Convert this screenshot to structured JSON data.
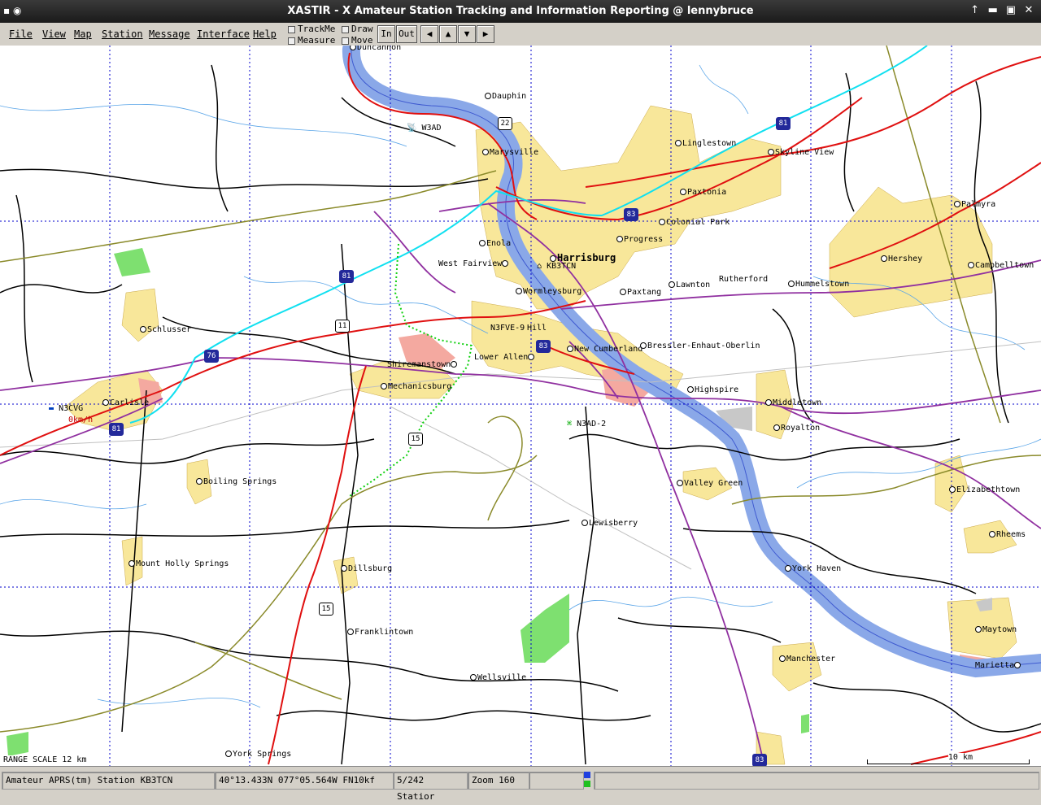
{
  "window": {
    "title": "XASTIR - X Amateur Station Tracking and Information Reporting @ lennybruce",
    "controls": [
      "↑",
      "▬",
      "▣",
      "✕"
    ]
  },
  "menu": {
    "items": [
      "File",
      "View",
      "Map",
      "Station",
      "Message",
      "Interface",
      "Help"
    ]
  },
  "toolbar": {
    "checks": [
      "TrackMe",
      "Measure",
      "Draw",
      "Move"
    ],
    "zoom_in": "In",
    "zoom_out": "Out",
    "arrows": [
      "◀",
      "▲",
      "▼",
      "▶"
    ]
  },
  "map": {
    "places": [
      {
        "name": "Duncannon"
      },
      {
        "name": "Dauphin"
      },
      {
        "name": "Marysville"
      },
      {
        "name": "Linglestown"
      },
      {
        "name": "Skyline View"
      },
      {
        "name": "Paxtonia"
      },
      {
        "name": "Colonial Park"
      },
      {
        "name": "Palmyra"
      },
      {
        "name": "Enola"
      },
      {
        "name": "Progress"
      },
      {
        "name": "Harrisburg"
      },
      {
        "name": "West Fairview"
      },
      {
        "name": "Hershey"
      },
      {
        "name": "Campbelltown"
      },
      {
        "name": "Wormleysburg"
      },
      {
        "name": "Paxtang"
      },
      {
        "name": "Lawnton"
      },
      {
        "name": "Rutherford"
      },
      {
        "name": "Hummelstown"
      },
      {
        "name": "Schlusser"
      },
      {
        "name": "Hill"
      },
      {
        "name": "New Cumberland"
      },
      {
        "name": "Bressler-Enhaut-Oberlin"
      },
      {
        "name": "Lower Allen"
      },
      {
        "name": "Shiremanstown"
      },
      {
        "name": "Mechanicsburg"
      },
      {
        "name": "Highspire"
      },
      {
        "name": "Middletown"
      },
      {
        "name": "Carlisle"
      },
      {
        "name": "Royalton"
      },
      {
        "name": "Boiling Springs"
      },
      {
        "name": "Valley Green"
      },
      {
        "name": "Elizabethtown"
      },
      {
        "name": "Lewisberry"
      },
      {
        "name": "Rheems"
      },
      {
        "name": "Mount Holly Springs"
      },
      {
        "name": "Dillsburg"
      },
      {
        "name": "York Haven"
      },
      {
        "name": "Franklintown"
      },
      {
        "name": "Maytown"
      },
      {
        "name": "Manchester"
      },
      {
        "name": "Marietta"
      },
      {
        "name": "Wellsville"
      },
      {
        "name": "York Springs"
      }
    ],
    "stations": [
      {
        "call": "W3AD"
      },
      {
        "call": "KB3TCN"
      },
      {
        "call": "N3FVE-9"
      },
      {
        "call": "N3AD-2"
      },
      {
        "call": "N3CVG"
      },
      {
        "call": "0km/h"
      }
    ],
    "shields": [
      {
        "num": "22",
        "type": "us"
      },
      {
        "num": "81",
        "type": "i"
      },
      {
        "num": "83",
        "type": "i"
      },
      {
        "num": "81",
        "type": "i"
      },
      {
        "num": "11",
        "type": "us"
      },
      {
        "num": "83",
        "type": "i"
      },
      {
        "num": "76",
        "type": "i"
      },
      {
        "num": "15",
        "type": "us"
      },
      {
        "num": "81",
        "type": "i"
      },
      {
        "num": "15",
        "type": "us"
      },
      {
        "num": "83",
        "type": "i"
      }
    ],
    "range_scale": "RANGE SCALE 12 km",
    "scale_bar": "10 km"
  },
  "status": {
    "station": "Amateur APRS(tm) Station KB3TCN",
    "coords": "40°13.433N  077°05.564W  FN10kf",
    "count": "5/242 Statior",
    "zoom": "Zoom 160"
  }
}
